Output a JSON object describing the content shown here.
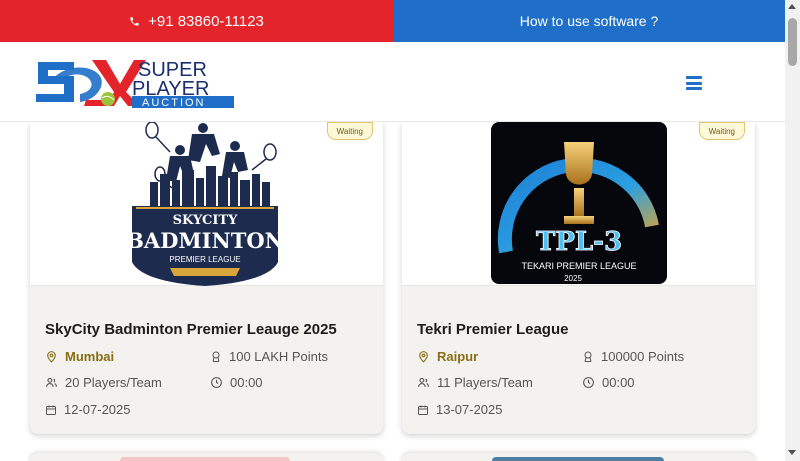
{
  "topbar": {
    "phone": "+91 83860-11123",
    "howto": "How to use software ?"
  },
  "brand": {
    "line1": "SUPER",
    "line2": "PLAYER",
    "line3": "AUCTION",
    "colors": {
      "red": "#e3242b",
      "blue": "#1f6fc8",
      "dark": "#1b2f6e"
    }
  },
  "cards": [
    {
      "status": "Waiting",
      "logo": {
        "line1": "SKYCITY",
        "line2": "BADMINTON",
        "line3": "PREMIER LEAGUE"
      },
      "title": "SkyCity Badminton Premier Leauge 2025",
      "city": "Mumbai",
      "points": "100 LAKH Points",
      "players": "20 Players/Team",
      "time": "00:00",
      "date": "12-07-2025"
    },
    {
      "status": "Waiting",
      "logo": {
        "line1": "TPL-3",
        "line2": "TEKARI PREMIER LEAGUE",
        "line3": "2025"
      },
      "title": "Tekri Premier League",
      "city": "Raipur",
      "points": "100000 Points",
      "players": "11 Players/Team",
      "time": "00:00",
      "date": "13-07-2025"
    }
  ],
  "icons": [
    "phone-icon",
    "menu-icon",
    "location-icon",
    "coin-icon",
    "users-icon",
    "clock-icon",
    "calendar-icon"
  ]
}
